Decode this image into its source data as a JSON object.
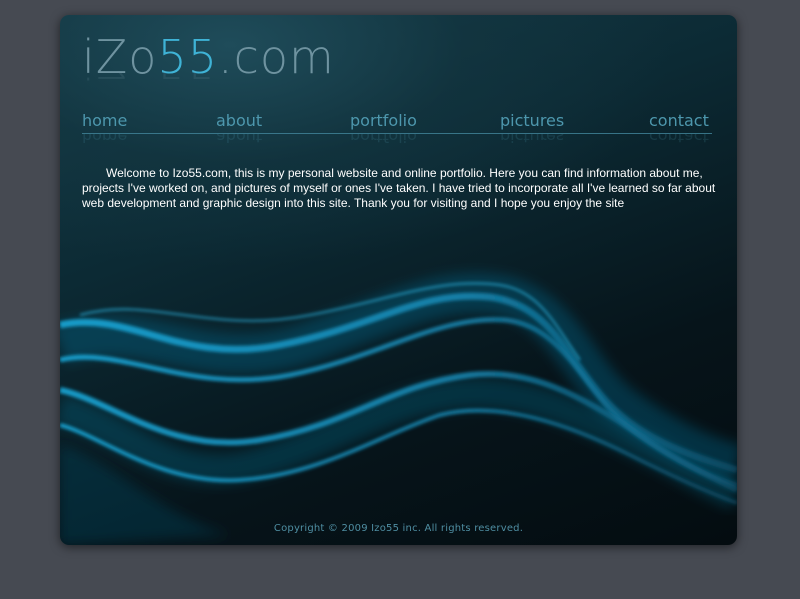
{
  "site": {
    "logo_prefix": "iZo",
    "logo_highlight": "55",
    "logo_suffix": ".com"
  },
  "nav": {
    "items": [
      {
        "label": "home"
      },
      {
        "label": "about"
      },
      {
        "label": "portfolio"
      },
      {
        "label": "pictures"
      },
      {
        "label": "contact"
      }
    ]
  },
  "content": {
    "welcome": "Welcome to Izo55.com, this is my personal website and online portfolio. Here you can find information about me, projects I've worked on, and pictures of myself or ones I've taken. I have tried to incorporate all I've learned so far about web development and graphic design into this site. Thank you for visiting and I hope you enjoy the site"
  },
  "footer": {
    "copyright": "Copyright © 2009 Izo55 inc. All rights reserved."
  },
  "colors": {
    "page_background": "#464a52",
    "panel_dark": "#06141a",
    "accent_cyan": "#3fb3d6",
    "nav_text": "#4d97ad",
    "body_text": "#ffffff"
  }
}
